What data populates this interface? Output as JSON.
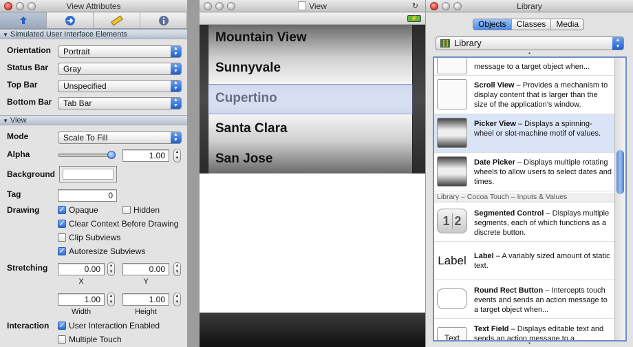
{
  "inspector": {
    "title": "View Attributes",
    "tab_icons": [
      "attributes-icon",
      "connections-icon",
      "size-icon",
      "identity-icon"
    ],
    "section1": "Simulated User Interface Elements",
    "orientation": {
      "label": "Orientation",
      "value": "Portrait"
    },
    "status_bar": {
      "label": "Status Bar",
      "value": "Gray"
    },
    "top_bar": {
      "label": "Top Bar",
      "value": "Unspecified"
    },
    "bottom_bar": {
      "label": "Bottom Bar",
      "value": "Tab Bar"
    },
    "section2": "View",
    "mode": {
      "label": "Mode",
      "value": "Scale To Fill"
    },
    "alpha": {
      "label": "Alpha",
      "value": "1.00",
      "level": 1.0
    },
    "background": {
      "label": "Background"
    },
    "tag": {
      "label": "Tag",
      "value": "0"
    },
    "drawing": {
      "label": "Drawing",
      "opaque": "Opaque",
      "hidden": "Hidden",
      "clear_context": "Clear Context Before Drawing",
      "clip": "Clip Subviews",
      "autoresize": "Autoresize Subviews"
    },
    "stretching": {
      "label": "Stretching",
      "x": "0.00",
      "y": "0.00",
      "width": "1.00",
      "height": "1.00",
      "x_label": "X",
      "y_label": "Y",
      "width_label": "Width",
      "height_label": "Height"
    },
    "interaction": {
      "label": "Interaction",
      "user_interaction": "User Interaction Enabled",
      "multiple_touch": "Multiple Touch"
    }
  },
  "view_window": {
    "title": "View",
    "picker_items": [
      "Mountain View",
      "Sunnyvale",
      "Cupertino",
      "Santa Clara",
      "San Jose"
    ]
  },
  "library": {
    "title": "Library",
    "tabs": [
      "Objects",
      "Classes",
      "Media"
    ],
    "selected": "Library",
    "items": [
      {
        "name": "",
        "desc": "message to a target object when..."
      },
      {
        "name": "Scroll View",
        "desc": " – Provides a mechanism to display content that is larger than the size of the application's window."
      },
      {
        "name": "Picker View",
        "desc": " – Displays a spinning-wheel or slot-machine motif of values."
      },
      {
        "name": "Date Picker",
        "desc": " – Displays multiple rotating wheels to allow users to select dates and times."
      },
      {
        "name": "Segmented Control",
        "desc": " – Displays multiple segments, each of which functions as a discrete button."
      },
      {
        "name": "Label",
        "desc": " – A variably sized amount of static text."
      },
      {
        "name": "Round Rect Button",
        "desc": " – Intercepts touch events and sends an action message to a target object when..."
      },
      {
        "name": "Text Field",
        "desc": " – Displays editable text and sends an action message to a..."
      }
    ],
    "group": "Library – Cocoa Touch – Inputs & Values",
    "label_thumb": "Label",
    "seg_thumb": [
      "1",
      "2"
    ],
    "text_thumb": "Text"
  }
}
